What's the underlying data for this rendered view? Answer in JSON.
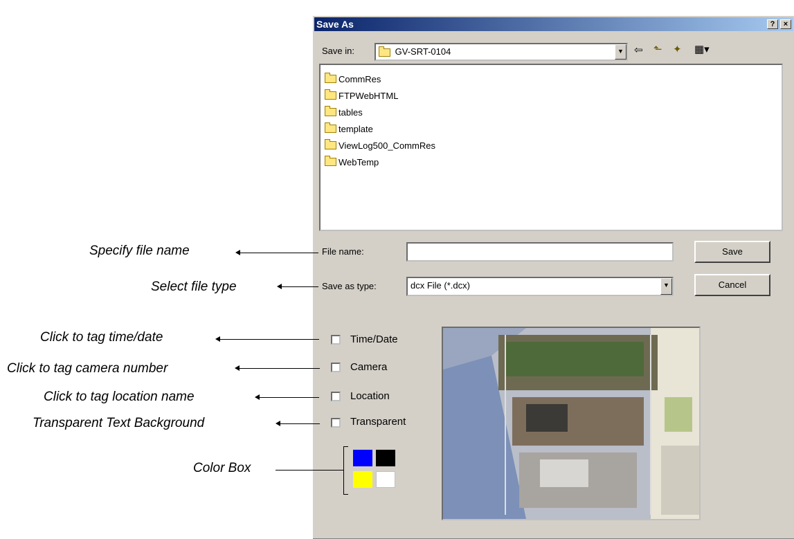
{
  "dialog": {
    "title": "Save As",
    "help_btn": "?",
    "close_btn": "×",
    "save_in_label": "Save in:",
    "save_in_value": "GV-SRT-0104",
    "folders": [
      "CommRes",
      "FTPWebHTML",
      "tables",
      "template",
      "ViewLog500_CommRes",
      "WebTemp"
    ],
    "file_name_label": "File name:",
    "file_name_value": "",
    "save_type_label": "Save as type:",
    "save_type_value": "dcx File (*.dcx)",
    "save_button": "Save",
    "cancel_button": "Cancel",
    "checkboxes": [
      "Time/Date",
      "Camera",
      "Location",
      "Transparent"
    ]
  },
  "annotations": {
    "file_name": "Specify file name",
    "file_type": "Select file type",
    "time_date": "Click to tag time/date",
    "camera": "Click to tag camera number",
    "location": "Click to tag location name",
    "transparent": "Transparent Text Background",
    "color_box": "Color Box"
  },
  "icons": [
    "folder-icon",
    "back-icon",
    "up-folder-icon",
    "new-folder-icon",
    "view-menu-icon"
  ],
  "colors": {
    "swatch_blue": "#0000ff",
    "swatch_black": "#000000",
    "swatch_yellow": "#ffff00",
    "swatch_white": "#ffffff"
  }
}
